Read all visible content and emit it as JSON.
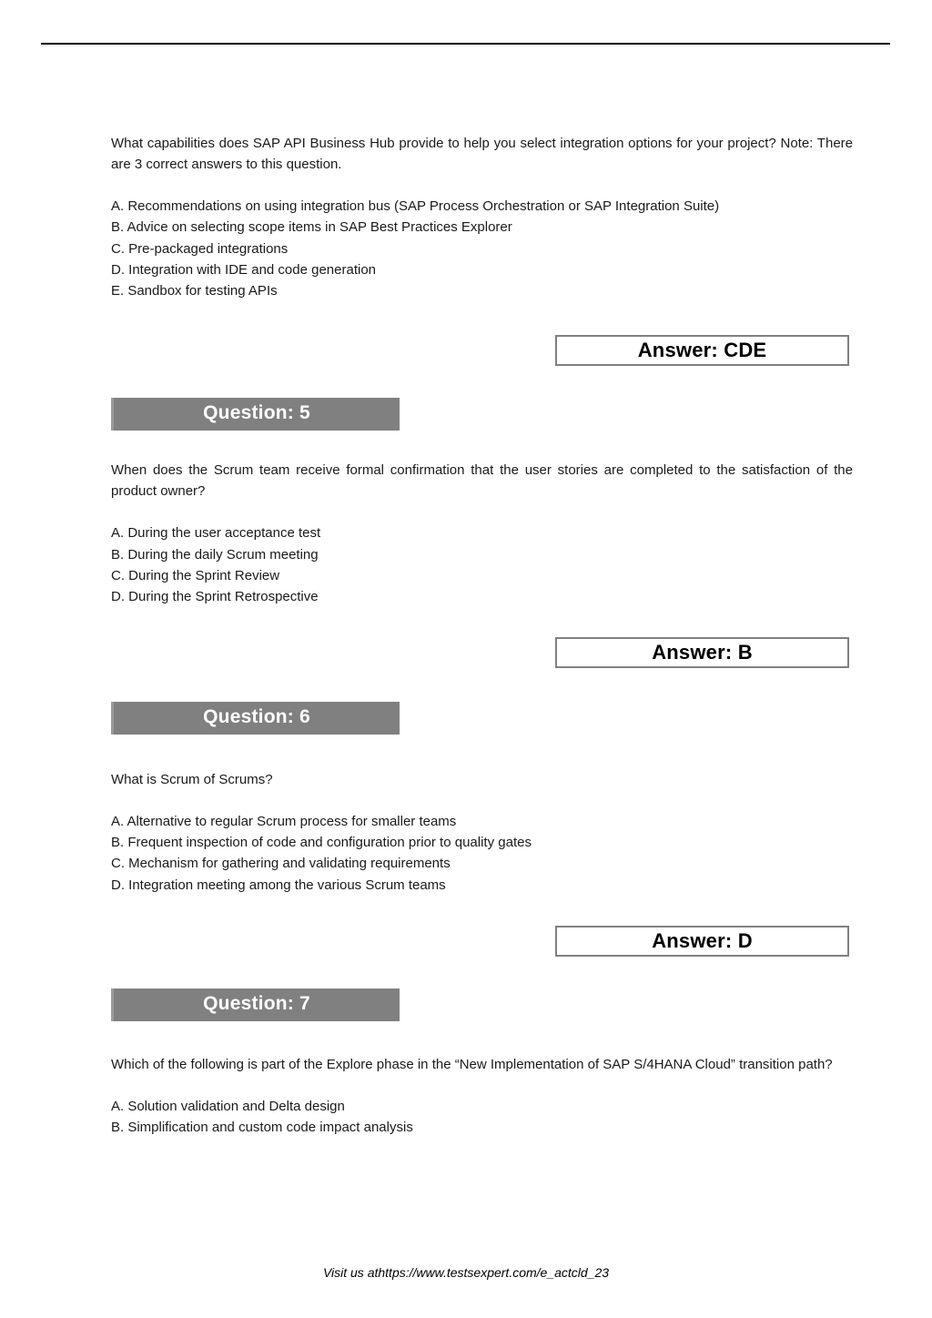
{
  "page": {
    "footer_text": "Visit us athttps://www.testsexpert.com/e_actcld_23",
    "colors": {
      "header_bar": "#808080",
      "answer_border": "#808080",
      "text": "#1a1a1a",
      "rule": "#000000"
    }
  },
  "blocks": [
    {
      "header": null,
      "stem": "What capabilities does SAP API Business Hub provide to help you select integration options for your project? Note: There are 3 correct answers to this question.",
      "options": [
        "A. Recommendations on using integration bus (SAP Process Orchestration or SAP Integration Suite)",
        "B. Advice on selecting scope items in SAP Best Practices Explorer",
        "C. Pre-packaged integrations",
        "D. Integration with IDE and code generation",
        "E. Sandbox for testing APIs"
      ],
      "answer": "Answer: CDE"
    },
    {
      "header": "Question: 5",
      "stem": "When does the Scrum team receive formal confirmation that the user stories are completed to the satisfaction of the product owner?",
      "options": [
        "A. During the user acceptance test",
        "B. During the daily Scrum meeting",
        "C. During the Sprint Review",
        "D. During the Sprint Retrospective"
      ],
      "answer": "Answer: B"
    },
    {
      "header": "Question: 6",
      "stem": "What is Scrum of Scrums?",
      "options": [
        "A. Alternative to regular Scrum process for smaller teams",
        "B. Frequent inspection of code and configuration prior to quality gates",
        "C. Mechanism for gathering and validating requirements",
        "D. Integration meeting among the various Scrum teams"
      ],
      "answer": "Answer: D"
    },
    {
      "header": "Question: 7",
      "stem": "Which of the following is part of the Explore phase in the “New Implementation of SAP S/4HANA Cloud” transition path?",
      "options": [
        "A. Solution validation and Delta design",
        "B. Simplification and custom code impact analysis"
      ],
      "answer": null
    }
  ]
}
